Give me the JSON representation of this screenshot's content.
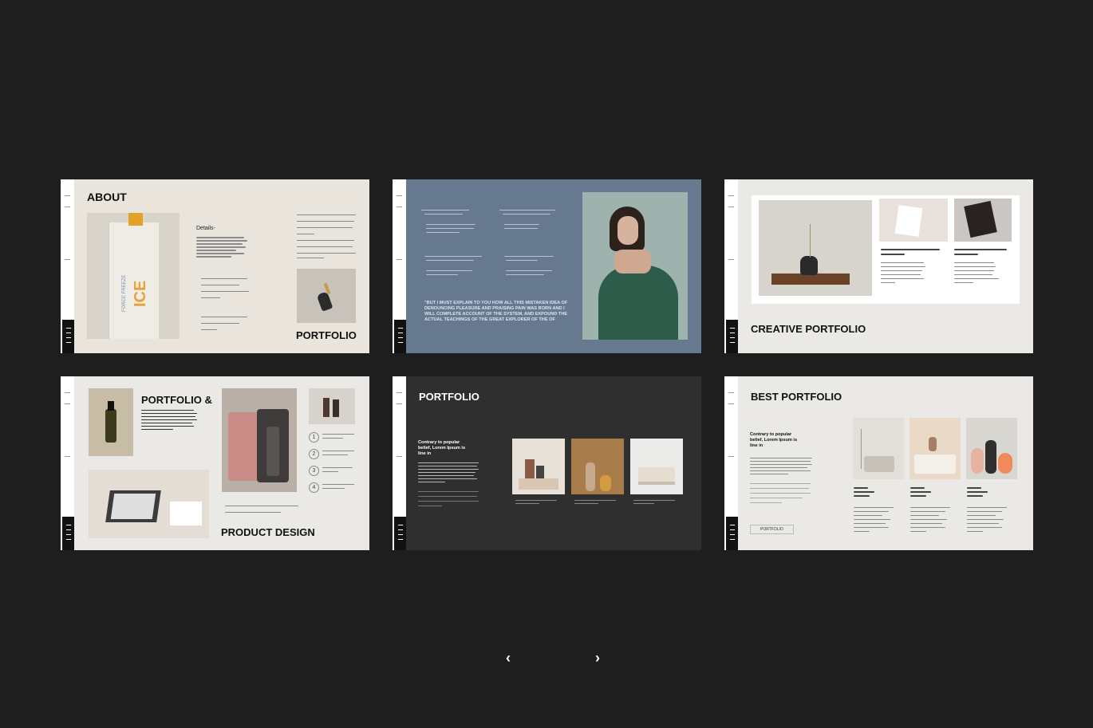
{
  "colors": {
    "background": "#1e1e1e",
    "beige": "#e9e5dc",
    "slate": "#66798f",
    "charcoal": "#2f2f2f",
    "light": "#eae9e6"
  },
  "slides": [
    {
      "title": "ABOUT",
      "subtitle": "PORTFOLIO",
      "details_label": "Details-",
      "bottle_text": "ICE",
      "bottle_sub": "FORCE FREEZE"
    },
    {
      "body": "\"BUT I MUST EXPLAIN TO YOU HOW ALL THIS MISTAKEN IDEA OF DENOUNCING PLEASURE AND PRAISING PAIN WAS BORN AND I WILL COMPLETE ACCOUNT OF THE SYSTEM, AND EXPOUND THE ACTUAL TEACHINGS OF THE GREAT EXPLORER OF THE OF"
    },
    {
      "title": "CREATIVE PORTFOLIO"
    },
    {
      "title": "PORTFOLIO &",
      "subtitle": "PRODUCT DESIGN",
      "steps": [
        "1",
        "2",
        "3",
        "4"
      ]
    },
    {
      "title": "PORTFOLIO",
      "lead": "Contrary to popular belief, Lorem Ipsum is line in"
    },
    {
      "title": "BEST PORTFOLIO",
      "lead": "Contrary to popular belief, Lorem Ipsum is line in",
      "button": "PORTFOLIO"
    }
  ],
  "navigation": {
    "prev": "‹",
    "next": "›"
  }
}
